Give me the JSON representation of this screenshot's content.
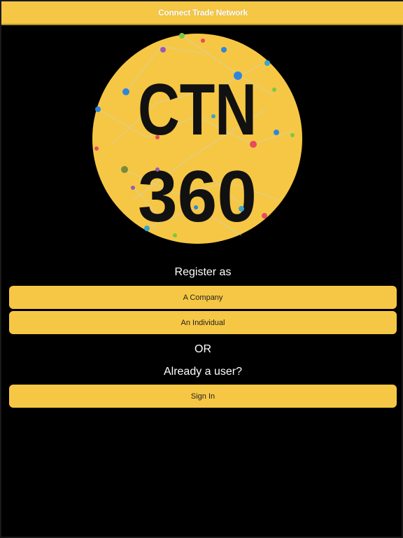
{
  "app": {
    "title": "Connect Trade Network"
  },
  "logo": {
    "line1": "CTN",
    "line2": "360",
    "circle_color": "#f6c744",
    "text_color": "#111111"
  },
  "register": {
    "heading": "Register as",
    "company_label": "A Company",
    "individual_label": "An Individual"
  },
  "or_label": "OR",
  "signin": {
    "heading": "Already a user?",
    "button_label": "Sign In"
  },
  "colors": {
    "accent": "#f6c744",
    "background": "#000000",
    "text_light": "#ffffff"
  }
}
